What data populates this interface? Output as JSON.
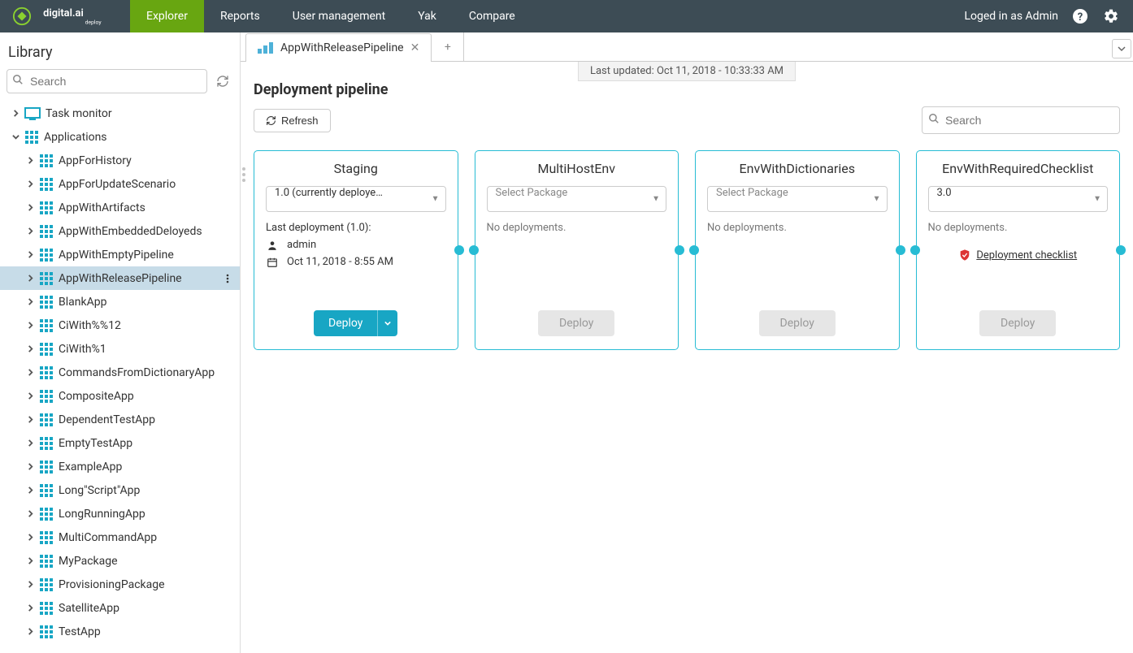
{
  "header": {
    "nav": [
      "Explorer",
      "Reports",
      "User management",
      "Yak",
      "Compare"
    ],
    "active_nav": 0,
    "login_text": "Loged in as Admin"
  },
  "sidebar": {
    "title": "Library",
    "search_placeholder": "Search",
    "root": [
      {
        "label": "Task monitor",
        "iconColor": "#18a6c4",
        "type": "monitor",
        "depth": 0
      },
      {
        "label": "Applications",
        "iconColor": "#18a6c4",
        "type": "grid",
        "depth": 0,
        "expanded": true
      }
    ],
    "apps": [
      "AppForHistory",
      "AppForUpdateScenario",
      "AppWithArtifacts",
      "AppWithEmbeddedDeloyeds",
      "AppWithEmptyPipeline",
      "AppWithReleasePipeline",
      "BlankApp",
      "CiWith%%12",
      "CiWith%1",
      "CommandsFromDictionaryApp",
      "CompositeApp",
      "DependentTestApp",
      "EmptyTestApp",
      "ExampleApp",
      "Long\"Script\"App",
      "LongRunningApp",
      "MultiCommandApp",
      "MyPackage",
      "ProvisioningPackage",
      "SatelliteApp",
      "TestApp"
    ],
    "selected_index": 5
  },
  "tab": {
    "label": "AppWithReleasePipeline"
  },
  "page": {
    "last_updated": "Last updated: Oct 11, 2018 - 10:33:33 AM",
    "title": "Deployment pipeline",
    "refresh_label": "Refresh",
    "search_placeholder": "Search"
  },
  "stages": [
    {
      "name": "Staging",
      "package": "1.0 (currently deploye…",
      "last_deploy_label": "Last deployment (1.0):",
      "user": "admin",
      "date": "Oct 11, 2018 - 8:55 AM",
      "deploy_label": "Deploy",
      "primary": true
    },
    {
      "name": "MultiHostEnv",
      "package_placeholder": "Select Package",
      "no_deploy": "No deployments.",
      "deploy_label": "Deploy",
      "primary": false
    },
    {
      "name": "EnvWithDictionaries",
      "package_placeholder": "Select Package",
      "no_deploy": "No deployments.",
      "deploy_label": "Deploy",
      "primary": false
    },
    {
      "name": "EnvWithRequiredChecklist",
      "package": "3.0",
      "no_deploy": "No deployments.",
      "checklist_label": "Deployment checklist",
      "deploy_label": "Deploy",
      "primary": false
    }
  ]
}
